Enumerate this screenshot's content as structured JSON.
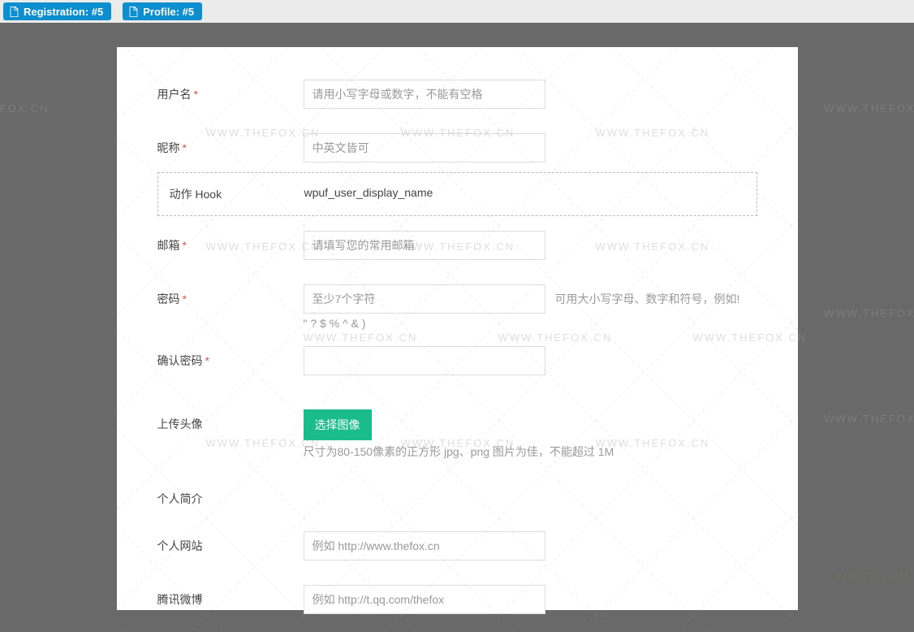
{
  "topbar": {
    "registration": "Registration: #5",
    "profile": "Profile: #5"
  },
  "form": {
    "username": {
      "label": "用户名",
      "placeholder": "请用小写字母或数字，不能有空格"
    },
    "nickname": {
      "label": "昵称",
      "placeholder": "中英文皆可"
    },
    "hook": {
      "label": "动作 Hook",
      "value": "wpuf_user_display_name"
    },
    "email": {
      "label": "邮箱",
      "placeholder": "请填写您的常用邮箱"
    },
    "password": {
      "label": "密码",
      "placeholder": "至少7个字符",
      "hint_inline": "可用大小写字母、数字和符号，例如!",
      "hint_below": "\" ? $ % ^ & )"
    },
    "confirm_password": {
      "label": "确认密码"
    },
    "avatar": {
      "label": "上传头像",
      "button": "选择图像",
      "hint": "尺寸为80-150像素的正方形 jpg、png 图片为佳，不能超过 1M"
    },
    "bio": {
      "label": "个人简介"
    },
    "website": {
      "label": "个人网站",
      "placeholder": "例如 http://www.thefox.cn"
    },
    "weibo": {
      "label": "腾讯微博",
      "placeholder": "例如 http://t.qq.com/thefox"
    }
  },
  "watermark": {
    "text": "WWW.THEFOX.CN",
    "corner": "MBXZB.COM"
  }
}
